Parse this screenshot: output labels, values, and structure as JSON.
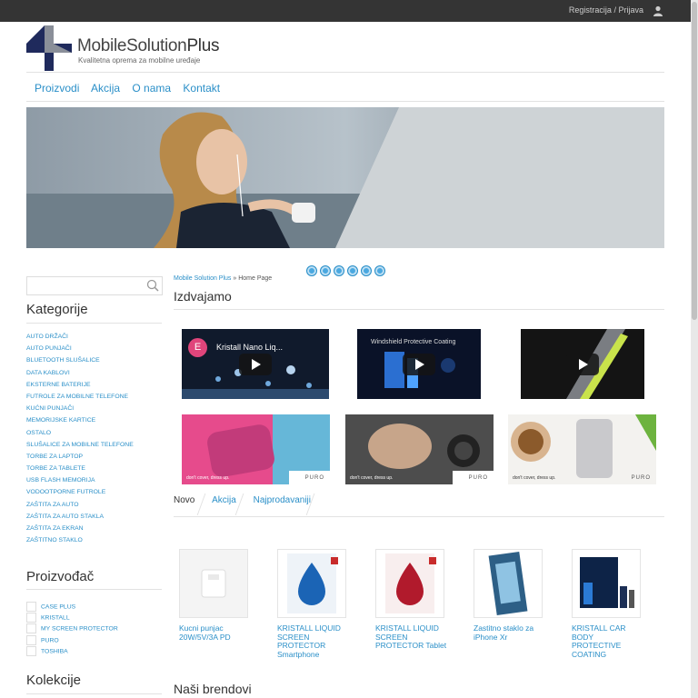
{
  "topbar": {
    "register": "Registracija",
    "sep": "/",
    "login": "Prijava"
  },
  "brand": {
    "name_a": "MobileSolution",
    "name_b": "Plus",
    "tagline": "Kvalitetna oprema za mobilne uređaje"
  },
  "nav": [
    "Proizvodi",
    "Akcija",
    "O nama",
    "Kontakt"
  ],
  "search": {
    "placeholder": ""
  },
  "breadcrumb": {
    "home": "Mobile Solution Plus",
    "sep": " » ",
    "current": "Home Page"
  },
  "featured": {
    "heading": "Izdvajamo",
    "videos": [
      {
        "avatar": "E",
        "title": "Kristall Nano Liq..."
      },
      {
        "title": "Windshield Protective Coating"
      },
      {
        "title": ""
      }
    ],
    "banners": [
      {
        "slogan": "don't cover, dress up.",
        "logo": "PURO"
      },
      {
        "slogan": "don't cover, dress up.",
        "logo": "PURO"
      },
      {
        "slogan": "don't cover, dress up.",
        "logo": "PURO"
      }
    ]
  },
  "sidebar": {
    "categories_title": "Kategorije",
    "categories": [
      "AUTO DRŽAČI",
      "AUTO PUNJAČI",
      "BLUETOOTH SLUŠALICE",
      "DATA KABLOVI",
      "EKSTERNE BATERIJE",
      "FUTROLE ZA MOBILNE TELEFONE",
      "KUĆNI PUNJAČI",
      "MEMORIJSKE KARTICE",
      "OSTALO",
      "SLUŠALICE ZA MOBILNE TELEFONE",
      "TORBE ZA LAPTOP",
      "TORBE ZA TABLETE",
      "USB FLASH MEMORIJA",
      "VODOOTPORNE FUTROLE",
      "ZAŠTITA ZA AUTO",
      "ZAŠTITA ZA AUTO STAKLA",
      "ZAŠTITA ZA EKRAN",
      "ZAŠTITNO STAKLO"
    ],
    "manufacturer_title": "Proizvođač",
    "manufacturers": [
      "CASE PLUS",
      "KRISTALL",
      "MY SCREEN PROTECTOR",
      "PURO",
      "TOSHIBA"
    ],
    "collections_title": "Kolekcije"
  },
  "tabs": [
    "Novo",
    "Akcija",
    "Najprodavaniji"
  ],
  "products": [
    {
      "name": "Kucni punjac 20W/5V/3A PD"
    },
    {
      "name": "KRISTALL LIQUID SCREEN PROTECTOR Smartphone"
    },
    {
      "name": "KRISTALL LIQUID SCREEN PROTECTOR Tablet"
    },
    {
      "name": "Zastitno staklo za iPhone Xr"
    },
    {
      "name": "KRISTALL CAR BODY PROTECTIVE COATING"
    }
  ],
  "brands_heading": "Naši brendovi",
  "colors": {
    "accent": "#2a8fc8",
    "topbar": "#343434",
    "logo_dark": "#1f2a5c",
    "logo_grey": "#8a8f99"
  }
}
